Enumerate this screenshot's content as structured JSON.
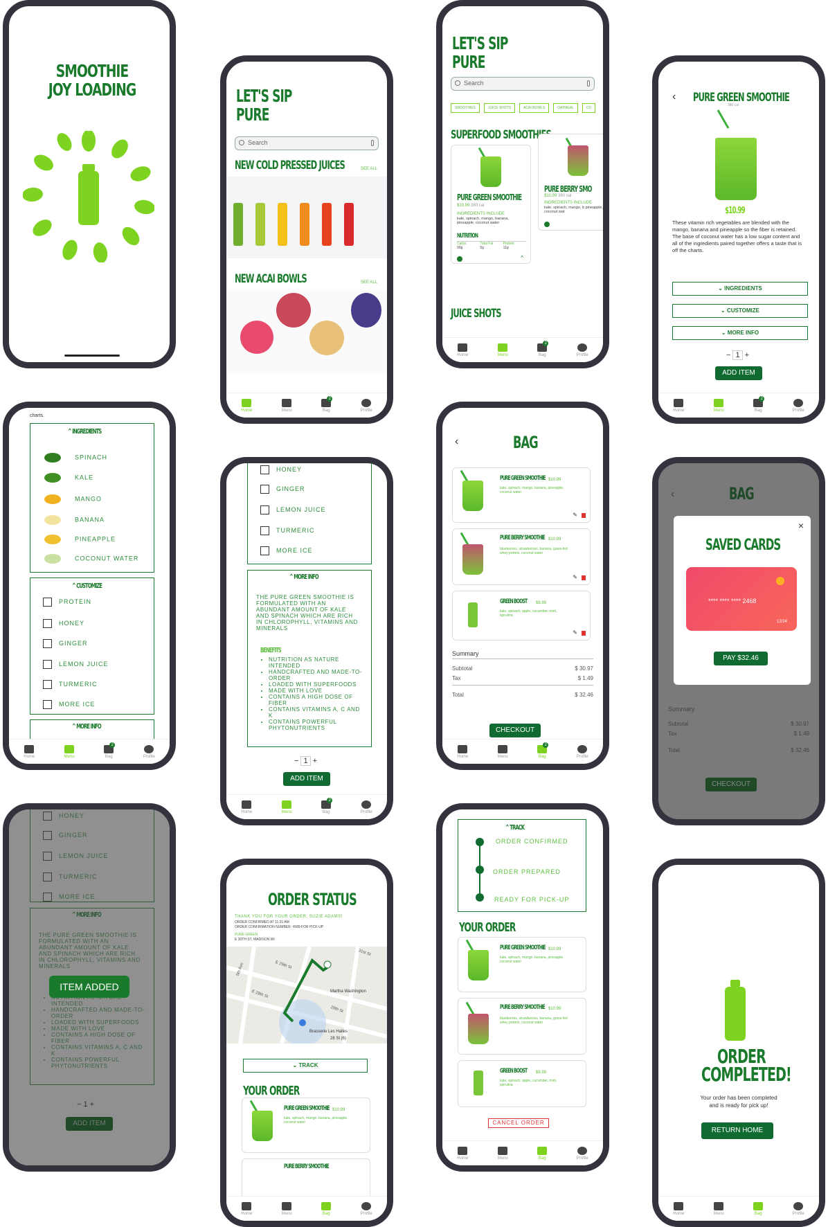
{
  "loading": {
    "title": "SMOOTHIE JOY LOADING"
  },
  "nav": {
    "home": "Home",
    "menu": "Menu",
    "bag": "Bag",
    "profile": "Profile",
    "bag_count": "2"
  },
  "home": {
    "title_l1": "LET'S SIP",
    "title_l2": "PURE",
    "search_placeholder": "Search",
    "sec1": "NEW COLD PRESSED JUICES",
    "see_all": "SEE ALL",
    "sec2": "NEW ACAI BOWLS"
  },
  "menu": {
    "title_l1": "LET'S SIP",
    "title_l2": "PURE",
    "search_placeholder": "Search",
    "chips": [
      "SMOOTHIES",
      "JUICE SHOTS",
      "ACAI BOWLS",
      "OATMEAL",
      "CO"
    ],
    "section": "SUPERFOOD SMOOTHIES",
    "section2": "JUICE SHOTS",
    "card1": {
      "name": "PURE GREEN SMOOTHIE",
      "price": "$10.99",
      "cal": "380 cal",
      "ing_label": "INGREDIENTS INCLUDE",
      "ing": "kale, spinach, mango, banana, pineapple, coconut water",
      "nutrition": "NUTRITION",
      "n1": "Carbs",
      "n1v": "90g",
      "n2": "Total Fat",
      "n2v": "5g",
      "n3": "Protein",
      "n3v": "11g"
    },
    "card2": {
      "name": "PURE BERRY SMO",
      "price": "$10.99",
      "cal": "380 cal",
      "ing_label": "INGREDIENTS INCLUDE",
      "ing": "kale, spinach, mango, b pineapple, coconut wat"
    }
  },
  "detail": {
    "title": "PURE GREEN SMOOTHIE",
    "cal": "380 cal",
    "price": "$10.99",
    "desc": "These vitamin rich vegetables are blended with the mango, banana and pineapple so the fiber is retained. The base of coconut water has a low sugar content and all of the ingredients paired together offers a taste that is off the charts.",
    "ingredients": "INGREDIENTS",
    "customize": "CUSTOMIZE",
    "more_info": "MORE INFO",
    "qty": "1",
    "add": "ADD ITEM"
  },
  "ingredients": {
    "charts": "charts.",
    "head": "INGREDIENTS",
    "items": [
      "SPINACH",
      "KALE",
      "MANGO",
      "BANANA",
      "PINEAPPLE",
      "COCONUT WATER"
    ],
    "custom_head": "CUSTOMIZE",
    "custom": [
      "PROTEIN",
      "HONEY",
      "GINGER",
      "LEMON JUICE",
      "TURMERIC",
      "MORE ICE"
    ],
    "more_info": "MORE INFO"
  },
  "moreinfo": {
    "custom": [
      "HONEY",
      "GINGER",
      "LEMON JUICE",
      "TURMERIC",
      "MORE ICE"
    ],
    "head": "MORE INFO",
    "text": "THE PURE GREEN SMOOTHIE IS FORMULATED WITH AN ABUNDANT AMOUNT OF KALE AND SPINACH WHICH ARE RICH IN CHLOROPHYLL, VITAMINS AND MINERALS",
    "benefits": "BENEFITS",
    "list": [
      "NUTRITION AS NATURE INTENDED",
      "HANDCRAFTED AND MADE-TO-ORDER",
      "LOADED WITH SUPERFOODS",
      "MADE WITH LOVE",
      "CONTAINS A HIGH DOSE OF FIBER",
      "CONTAINS VITAMINS A, C AND K",
      "CONTAINS POWERFUL PHYTONUTRIENTS"
    ],
    "qty": "1",
    "add": "ADD ITEM"
  },
  "bag": {
    "title": "BAG",
    "items": [
      {
        "name": "PURE GREEN SMOOTHIE",
        "price": "$10.99",
        "desc": "kale, spinach, mango, banana, pineapple, coconut water"
      },
      {
        "name": "PURE BERRY SMOOTHIE",
        "price": "$10.99",
        "desc": "blueberries, strawberries, banana, grass-fed whey protein, coconut water"
      },
      {
        "name": "GREEN BOOST",
        "price": "$8.99",
        "desc": "kale, spinach, apple, cucumber, mint, spirulina"
      }
    ],
    "summary": "Summary",
    "subtotal": "Subtotal",
    "subtotal_v": "$ 30.97",
    "tax": "Tax",
    "tax_v": "$ 1.49",
    "total": "Total",
    "total_v": "$ 32.46",
    "checkout": "CHECKOUT"
  },
  "cards": {
    "title": "SAVED CARDS",
    "number": "**** **** **** 2468",
    "exp": "12/24",
    "pay": "PAY $32.46",
    "close": "×"
  },
  "added": {
    "toast": "ITEM ADDED"
  },
  "status": {
    "title": "ORDER STATUS",
    "thanks": "THANK YOU FOR YOUR ORDER, SUZIE ADAMS!",
    "confirmed": "ORDER CONFIRMED AT 11:31 AM",
    "conf_no": "ORDER CONFIRMATION NUMBER: #589 FOR PICK-UP",
    "store": "PURE GREEN",
    "addr": "E 30TH ST, MADISON WI",
    "track": "TRACK",
    "your_order": "YOUR ORDER",
    "map_labels": [
      "E 29th St",
      "E 28th St",
      "Martha Washington",
      "Brasserie Les Halles",
      "28 St (6)",
      "31st St",
      "5th Ave",
      "29th St"
    ]
  },
  "track": {
    "head": "TRACK",
    "steps": [
      "ORDER CONFIRMED",
      "ORDER PREPARED",
      "READY FOR PICK-UP"
    ],
    "your_order": "YOUR ORDER",
    "cancel": "CANCEL ORDER"
  },
  "complete": {
    "title_l1": "ORDER",
    "title_l2": "COMPLETED!",
    "msg1": "Your order has been completed",
    "msg2": "and is ready for pick up!",
    "btn": "RETURN HOME"
  },
  "colors": {
    "green": "#1a7a2c",
    "lime": "#7ed321",
    "frame": "#34323d"
  }
}
